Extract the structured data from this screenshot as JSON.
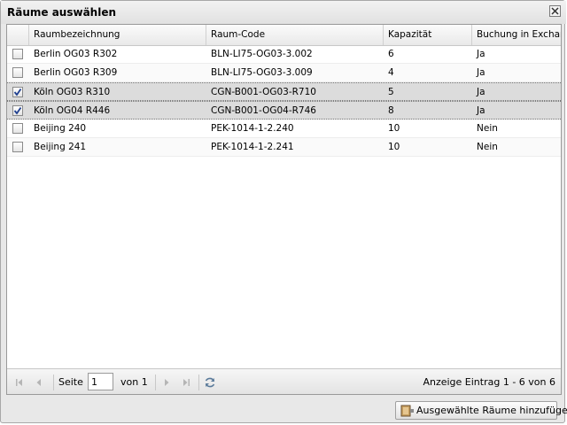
{
  "dialog": {
    "title": "Räume auswählen",
    "close_icon": "close-icon"
  },
  "grid": {
    "columns": [
      "Raumbezeichnung",
      "Raum-Code",
      "Kapazität",
      "Buchung in Exchange"
    ],
    "rows": [
      {
        "checked": false,
        "name": "Berlin OG03 R302",
        "code": "BLN-LI75-OG03-3.002",
        "capacity": "6",
        "exchange": "Ja"
      },
      {
        "checked": false,
        "name": "Berlin OG03 R309",
        "code": "BLN-LI75-OG03-3.009",
        "capacity": "4",
        "exchange": "Ja"
      },
      {
        "checked": true,
        "name": "Köln OG03 R310",
        "code": "CGN-B001-OG03-R710",
        "capacity": "5",
        "exchange": "Ja"
      },
      {
        "checked": true,
        "name": "Köln OG04 R446",
        "code": "CGN-B001-OG04-R746",
        "capacity": "8",
        "exchange": "Ja"
      },
      {
        "checked": false,
        "name": "Beijing 240",
        "code": "PEK-1014-1-2.240",
        "capacity": "10",
        "exchange": "Nein"
      },
      {
        "checked": false,
        "name": "Beijing 241",
        "code": "PEK-1014-1-2.241",
        "capacity": "10",
        "exchange": "Nein"
      }
    ]
  },
  "paging": {
    "page_label": "Seite",
    "page_value": "1",
    "of_label": "von 1",
    "status": "Anzeige Eintrag 1 - 6 von 6",
    "icons": [
      "first-page-icon",
      "prev-page-icon",
      "next-page-icon",
      "last-page-icon",
      "refresh-icon"
    ]
  },
  "footer": {
    "add_label": "Ausgewählte Räume hinzufügen",
    "add_icon": "door-icon"
  },
  "colors": {
    "selected_row": "#dcdcdc",
    "border": "#999999"
  }
}
